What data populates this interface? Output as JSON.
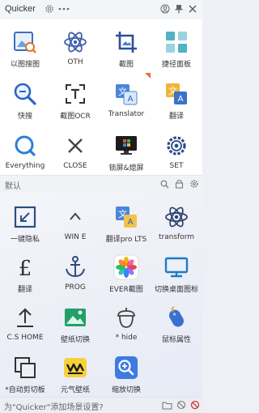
{
  "titlebar": {
    "title": "Quicker"
  },
  "top_actions": [
    {
      "label": "以图搜图",
      "icon": "image-search-icon"
    },
    {
      "label": "OTH",
      "icon": "atom-icon"
    },
    {
      "label": "截图",
      "icon": "crop-icon"
    },
    {
      "label": "捷径面板",
      "icon": "panel-icon"
    },
    {
      "label": "快搜",
      "icon": "quick-search-icon"
    },
    {
      "label": "截图OCR",
      "icon": "ocr-icon"
    },
    {
      "label": "Translator",
      "icon": "translate-icon"
    },
    {
      "label": "翻译",
      "icon": "translate-2-icon"
    },
    {
      "label": "Everything",
      "icon": "everything-search-icon"
    },
    {
      "label": "CLOSE",
      "icon": "close-x-icon"
    },
    {
      "label": "锁屏&熄屏",
      "icon": "windows-lock-icon"
    },
    {
      "label": "SET",
      "icon": "settings-gear-icon"
    }
  ],
  "section": {
    "label": "默认"
  },
  "bottom_actions": [
    {
      "label": "一键隐私",
      "icon": "privacy-shrink-icon"
    },
    {
      "label": "WIN E",
      "icon": "chevron-up-icon"
    },
    {
      "label": "翻译pro LTS",
      "icon": "translate-pro-icon"
    },
    {
      "label": "transform",
      "icon": "transform-atom-icon"
    },
    {
      "label": "翻译",
      "icon": "pound-icon"
    },
    {
      "label": "PROG",
      "icon": "anchor-icon"
    },
    {
      "label": "EVER截图",
      "icon": "photos-pinwheel-icon"
    },
    {
      "label": "切换桌面图标",
      "icon": "monitor-icon"
    },
    {
      "label": "C.S HOME",
      "icon": "upload-arrow-icon"
    },
    {
      "label": "壁纸切换",
      "icon": "wallpaper-image-icon"
    },
    {
      "label": "* hide",
      "icon": "acorn-icon"
    },
    {
      "label": "鼠标属性",
      "icon": "mouse-icon"
    },
    {
      "label": "*自动剪切板",
      "icon": "clipboard-copy-icon"
    },
    {
      "label": "元气壁纸",
      "icon": "yuanqi-logo-icon"
    },
    {
      "label": "缩放切换",
      "icon": "zoom-search-icon"
    }
  ],
  "status": {
    "text": "为\"Quicker\"添加场景设置?"
  }
}
